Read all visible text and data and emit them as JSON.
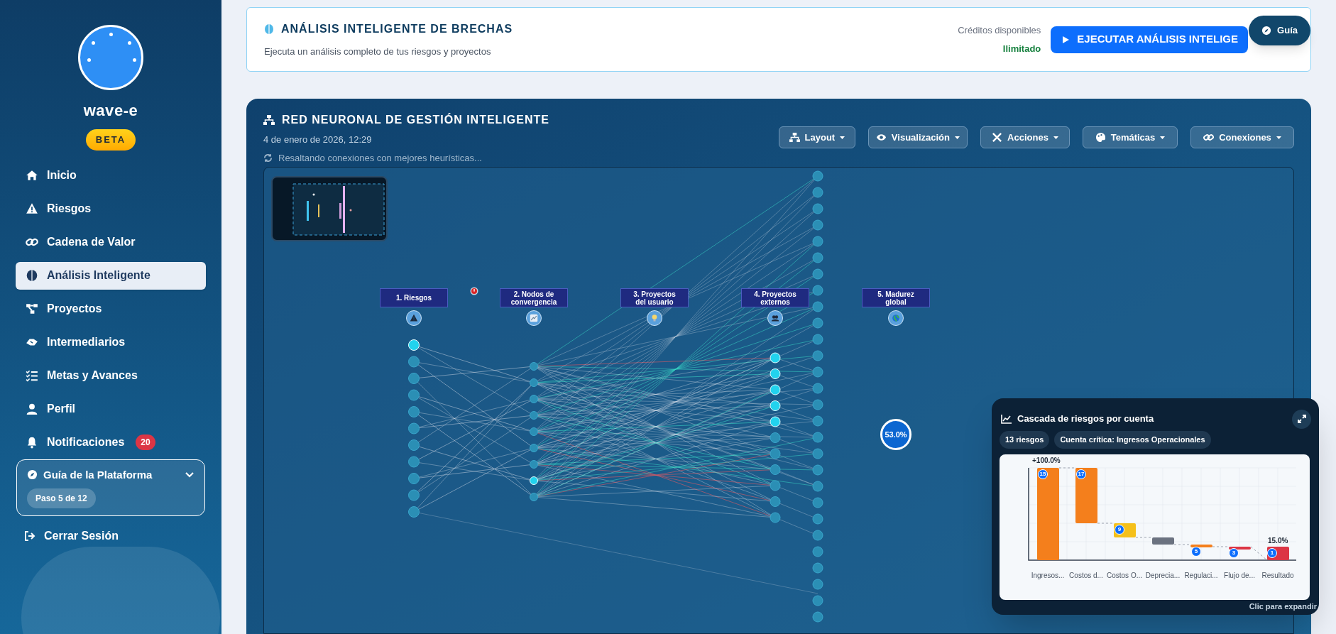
{
  "sidebar": {
    "brand": "wave-e",
    "badge": "BETA",
    "items": [
      {
        "label": "Inicio",
        "selected": false
      },
      {
        "label": "Riesgos",
        "selected": false
      },
      {
        "label": "Cadena de Valor",
        "selected": false
      },
      {
        "label": "Análisis Inteligente",
        "selected": true
      },
      {
        "label": "Proyectos",
        "selected": false
      },
      {
        "label": "Intermediarios",
        "selected": false
      },
      {
        "label": "Metas y Avances",
        "selected": false
      },
      {
        "label": "Perfil",
        "selected": false
      },
      {
        "label": "Notificaciones",
        "selected": false,
        "count": "20"
      }
    ],
    "guide": {
      "title": "Guía de la Plataforma",
      "step": "Paso 5 de 12",
      "expanded": false
    },
    "logout": "Cerrar Sesión"
  },
  "header_card": {
    "title": "ANÁLISIS INTELIGENTE DE BRECHAS",
    "subtitle": "Ejecuta un análisis completo de tus riesgos y proyectos",
    "credits_label": "Créditos disponibles",
    "credits_value": "Ilimitado",
    "run_button": "EJECUTAR ANÁLISIS INTELIGE"
  },
  "guide_button": "Guía",
  "network": {
    "title": "RED NEURONAL DE GESTIÓN INTELIGENTE",
    "date": "4 de enero de 2026, 12:29",
    "status": "Resaltando conexiones con mejores heurísticas...",
    "toolbar": [
      "Layout",
      "Visualización",
      "Acciones",
      "Temáticas",
      "Conexiones"
    ],
    "columns": [
      "1. Riesgos",
      "2. Nodos de convergencia",
      "3. Proyectos del usuario",
      "4. Proyectos externos",
      "5. Madurez global"
    ],
    "maturity": "53.0%"
  },
  "cascade": {
    "title": "Cascada de riesgos por cuenta",
    "chips": [
      "13 riesgos",
      "Cuenta crítica: Ingresos Operacionales"
    ],
    "start_label": "+100.0%",
    "end_label": "15.0%",
    "bars": [
      {
        "label": "Ingresos...",
        "badge": "15",
        "color": "#f47f1c"
      },
      {
        "label": "Costos d...",
        "badge": "17",
        "color": "#f47f1c"
      },
      {
        "label": "Costos O...",
        "badge": "9",
        "color": "#f5c01a"
      },
      {
        "label": "Deprecia...",
        "color": "#6b7280"
      },
      {
        "label": "Regulaci...",
        "badge": "5",
        "color": "#f47f1c"
      },
      {
        "label": "Flujo de...",
        "badge": "3",
        "color": "#dc3545"
      },
      {
        "label": "Resultado",
        "badge": "1",
        "color": "#dc3545"
      }
    ],
    "hint": "Clic para expandir"
  }
}
